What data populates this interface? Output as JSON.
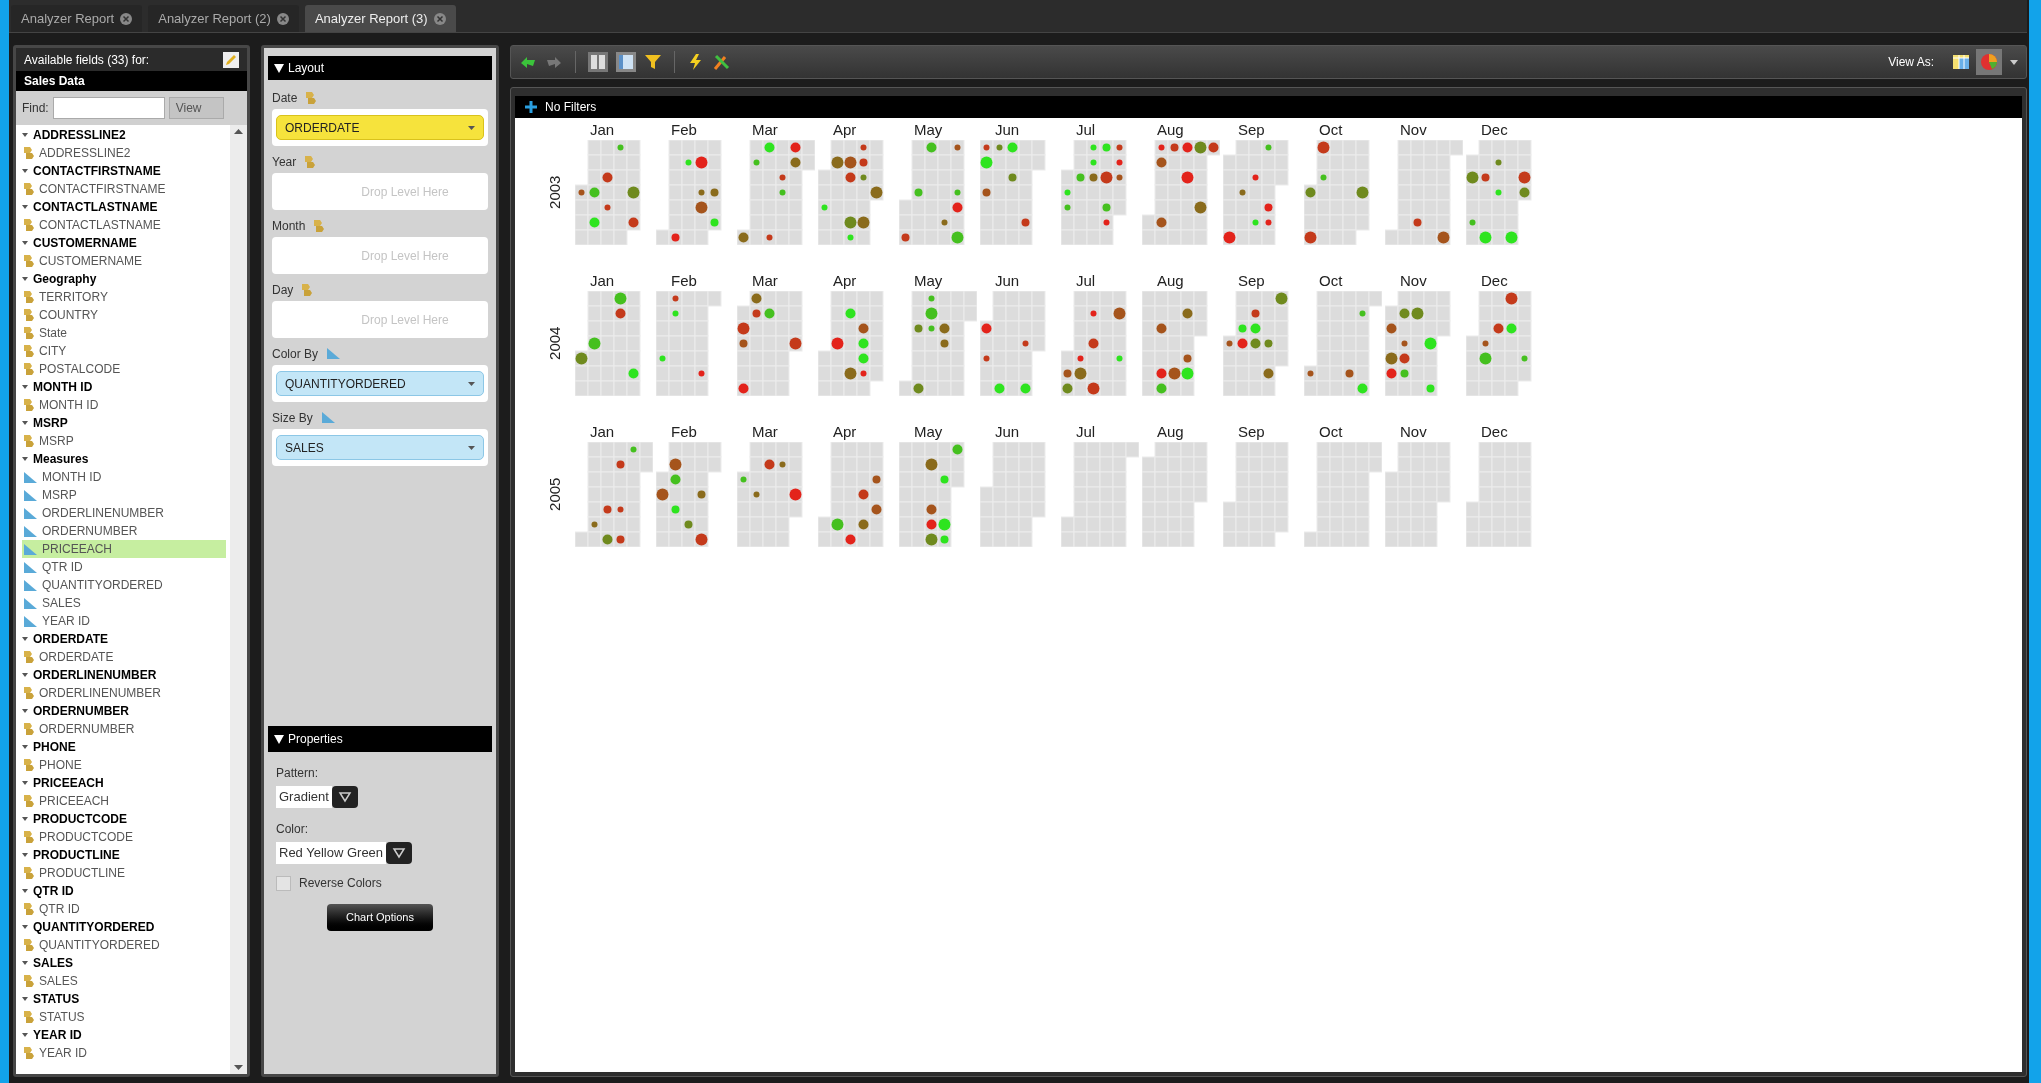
{
  "tabs": [
    {
      "label": "Analyzer Report",
      "selected": false
    },
    {
      "label": "Analyzer Report (2)",
      "selected": false
    },
    {
      "label": "Analyzer Report (3)",
      "selected": true
    }
  ],
  "fields_panel": {
    "title": "Available fields (33) for:",
    "source": "Sales Data",
    "find_label": "Find:",
    "view_button": "View",
    "groups": [
      {
        "label": "ADDRESSLINE2",
        "expanded": true,
        "children": [
          {
            "label": "ADDRESSLINE2",
            "kind": "level",
            "selected": false
          }
        ]
      },
      {
        "label": "CONTACTFIRSTNAME",
        "expanded": true,
        "children": [
          {
            "label": "CONTACTFIRSTNAME",
            "kind": "level",
            "selected": false
          }
        ]
      },
      {
        "label": "CONTACTLASTNAME",
        "expanded": true,
        "children": [
          {
            "label": "CONTACTLASTNAME",
            "kind": "level",
            "selected": false
          }
        ]
      },
      {
        "label": "CUSTOMERNAME",
        "expanded": true,
        "children": [
          {
            "label": "CUSTOMERNAME",
            "kind": "level",
            "selected": false
          }
        ]
      },
      {
        "label": "Geography",
        "expanded": true,
        "children": [
          {
            "label": "TERRITORY",
            "kind": "level",
            "selected": false
          },
          {
            "label": "COUNTRY",
            "kind": "level",
            "selected": false
          },
          {
            "label": "State",
            "kind": "level",
            "selected": false
          },
          {
            "label": "CITY",
            "kind": "level",
            "selected": false
          },
          {
            "label": "POSTALCODE",
            "kind": "level",
            "selected": false
          }
        ]
      },
      {
        "label": "MONTH ID",
        "expanded": true,
        "children": [
          {
            "label": "MONTH ID",
            "kind": "level",
            "selected": false
          }
        ]
      },
      {
        "label": "MSRP",
        "expanded": true,
        "children": [
          {
            "label": "MSRP",
            "kind": "level",
            "selected": false
          }
        ]
      },
      {
        "label": "Measures",
        "expanded": true,
        "children": [
          {
            "label": "MONTH ID",
            "kind": "measure",
            "selected": false
          },
          {
            "label": "MSRP",
            "kind": "measure",
            "selected": false
          },
          {
            "label": "ORDERLINENUMBER",
            "kind": "measure",
            "selected": false
          },
          {
            "label": "ORDERNUMBER",
            "kind": "measure",
            "selected": false
          },
          {
            "label": "PRICEEACH",
            "kind": "measure",
            "selected": true
          },
          {
            "label": "QTR ID",
            "kind": "measure",
            "selected": false
          },
          {
            "label": "QUANTITYORDERED",
            "kind": "measure",
            "selected": false
          },
          {
            "label": "SALES",
            "kind": "measure",
            "selected": false
          },
          {
            "label": "YEAR ID",
            "kind": "measure",
            "selected": false
          }
        ]
      },
      {
        "label": "ORDERDATE",
        "expanded": true,
        "children": [
          {
            "label": "ORDERDATE",
            "kind": "level",
            "selected": false
          }
        ]
      },
      {
        "label": "ORDERLINENUMBER",
        "expanded": true,
        "children": [
          {
            "label": "ORDERLINENUMBER",
            "kind": "level",
            "selected": false
          }
        ]
      },
      {
        "label": "ORDERNUMBER",
        "expanded": true,
        "children": [
          {
            "label": "ORDERNUMBER",
            "kind": "level",
            "selected": false
          }
        ]
      },
      {
        "label": "PHONE",
        "expanded": true,
        "children": [
          {
            "label": "PHONE",
            "kind": "level",
            "selected": false
          }
        ]
      },
      {
        "label": "PRICEEACH",
        "expanded": true,
        "children": [
          {
            "label": "PRICEEACH",
            "kind": "level",
            "selected": false
          }
        ]
      },
      {
        "label": "PRODUCTCODE",
        "expanded": true,
        "children": [
          {
            "label": "PRODUCTCODE",
            "kind": "level",
            "selected": false
          }
        ]
      },
      {
        "label": "PRODUCTLINE",
        "expanded": true,
        "children": [
          {
            "label": "PRODUCTLINE",
            "kind": "level",
            "selected": false
          }
        ]
      },
      {
        "label": "QTR ID",
        "expanded": true,
        "children": [
          {
            "label": "QTR ID",
            "kind": "level",
            "selected": false
          }
        ]
      },
      {
        "label": "QUANTITYORDERED",
        "expanded": true,
        "children": [
          {
            "label": "QUANTITYORDERED",
            "kind": "level",
            "selected": false
          }
        ]
      },
      {
        "label": "SALES",
        "expanded": true,
        "children": [
          {
            "label": "SALES",
            "kind": "level",
            "selected": false
          }
        ]
      },
      {
        "label": "STATUS",
        "expanded": true,
        "children": [
          {
            "label": "STATUS",
            "kind": "level",
            "selected": false
          }
        ]
      },
      {
        "label": "YEAR ID",
        "expanded": true,
        "children": [
          {
            "label": "YEAR ID",
            "kind": "level",
            "selected": false
          }
        ]
      }
    ]
  },
  "layout": {
    "title": "Layout",
    "slots": [
      {
        "label": "Date",
        "kind": "level",
        "value": "ORDERDATE"
      },
      {
        "label": "Year",
        "kind": "level",
        "placeholder": "Drop Level Here"
      },
      {
        "label": "Month",
        "kind": "level",
        "placeholder": "Drop Level Here"
      },
      {
        "label": "Day",
        "kind": "level",
        "placeholder": "Drop Level Here"
      },
      {
        "label": "Color By",
        "kind": "measure",
        "value": "QUANTITYORDERED"
      },
      {
        "label": "Size By",
        "kind": "measure",
        "value": "SALES"
      }
    ]
  },
  "properties": {
    "title": "Properties",
    "pattern_label": "Pattern:",
    "pattern": "Gradient",
    "color_label": "Color:",
    "color_scheme": "Red Yellow Green",
    "reverse_colors": {
      "label": "Reverse Colors",
      "checked": false
    },
    "chart_options_button": "Chart Options"
  },
  "toolbar": {
    "view_as_label": "View As:",
    "view_options": [
      {
        "kind": "table",
        "selected": false
      },
      {
        "kind": "pie",
        "selected": true
      }
    ]
  },
  "filters": {
    "label": "No Filters"
  },
  "calendar": {
    "years": [
      {
        "label": "2003",
        "months": [
          {
            "label": "Jan",
            "dots": true
          },
          {
            "label": "Feb",
            "dots": true
          },
          {
            "label": "Mar",
            "dots": true
          },
          {
            "label": "Apr",
            "dots": true
          },
          {
            "label": "May",
            "dots": true
          },
          {
            "label": "Jun",
            "dots": true
          },
          {
            "label": "Jul",
            "dots": true
          },
          {
            "label": "Aug",
            "dots": true
          },
          {
            "label": "Sep",
            "dots": true
          },
          {
            "label": "Oct",
            "dots": true
          },
          {
            "label": "Nov",
            "dots": true
          },
          {
            "label": "Dec",
            "dots": true
          }
        ]
      },
      {
        "label": "2004",
        "months": [
          {
            "label": "Jan",
            "dots": true
          },
          {
            "label": "Feb",
            "dots": true
          },
          {
            "label": "Mar",
            "dots": true
          },
          {
            "label": "Apr",
            "dots": true
          },
          {
            "label": "May",
            "dots": true
          },
          {
            "label": "Jun",
            "dots": true
          },
          {
            "label": "Jul",
            "dots": true
          },
          {
            "label": "Aug",
            "dots": true
          },
          {
            "label": "Sep",
            "dots": true
          },
          {
            "label": "Oct",
            "dots": true
          },
          {
            "label": "Nov",
            "dots": true
          },
          {
            "label": "Dec",
            "dots": true
          }
        ]
      },
      {
        "label": "2005",
        "months": [
          {
            "label": "Jan",
            "dots": true
          },
          {
            "label": "Feb",
            "dots": true
          },
          {
            "label": "Mar",
            "dots": true
          },
          {
            "label": "Apr",
            "dots": true
          },
          {
            "label": "May",
            "dots": true
          },
          {
            "label": "Jun",
            "dots": false
          },
          {
            "label": "Jul",
            "dots": false
          },
          {
            "label": "Aug",
            "dots": false
          },
          {
            "label": "Sep",
            "dots": false
          },
          {
            "label": "Oct",
            "dots": false
          },
          {
            "label": "Nov",
            "dots": false
          },
          {
            "label": "Dec",
            "dots": false
          }
        ]
      }
    ]
  }
}
